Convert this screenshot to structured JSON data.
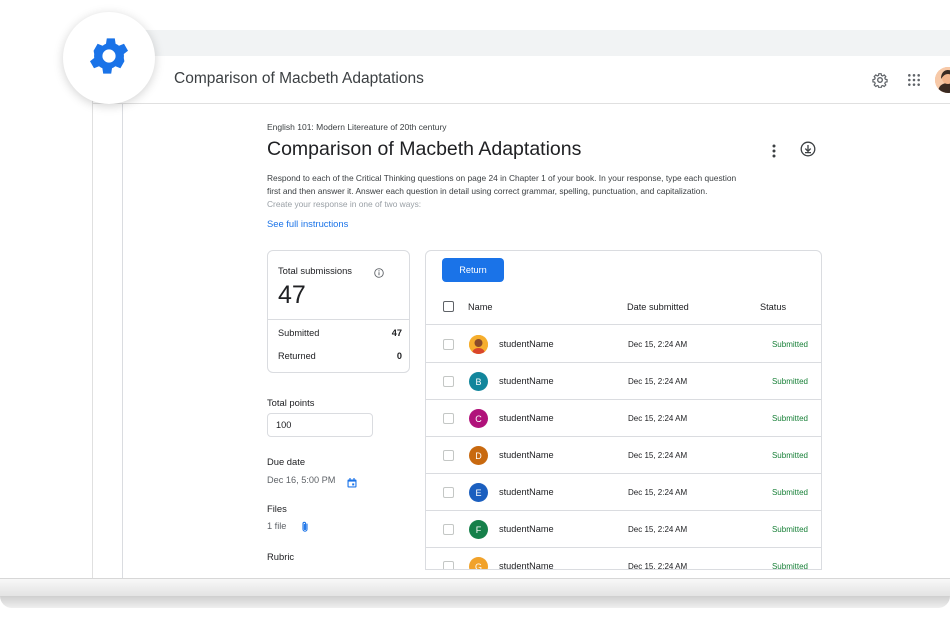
{
  "app": {
    "title": "Comparison of Macbeth Adaptations"
  },
  "header_icons": {
    "settings": "settings-gear-icon",
    "apps": "apps-grid-icon",
    "avatar": "user-avatar"
  },
  "assignment": {
    "course": "English 101: Modern Litereature of 20th century",
    "title": "Comparison of Macbeth Adaptations",
    "instructions_line1": "Respond to each of the Critical Thinking questions on page 24 in Chapter 1 of your book. In your response, type each question",
    "instructions_line2": "first and then answer it. Answer each question in detail using correct grammar, spelling, punctuation, and capitalization.",
    "instructions_line3": "Create your response in one of two ways:",
    "full_instructions_link": "See full instructions"
  },
  "submissions": {
    "label": "Total submissions",
    "total": "47",
    "submitted_label": "Submitted",
    "submitted_count": "47",
    "returned_label": "Returned",
    "returned_count": "0"
  },
  "details": {
    "points_label": "Total points",
    "points_value": "100",
    "due_label": "Due date",
    "due_value": "Dec 16, 5:00 PM",
    "files_label": "Files",
    "files_value": "1 file",
    "rubric_label": "Rubric"
  },
  "table": {
    "return_button": "Return",
    "columns": {
      "name": "Name",
      "date": "Date submitted",
      "status": "Status"
    },
    "rows": [
      {
        "initial": "",
        "avatar_color": "#f6ae2d",
        "name": "studentName",
        "date": "Dec 15, 2:24 AM",
        "status": "Submitted"
      },
      {
        "initial": "B",
        "avatar_color": "#12869c",
        "name": "studentName",
        "date": "Dec 15, 2:24 AM",
        "status": "Submitted"
      },
      {
        "initial": "C",
        "avatar_color": "#b0127a",
        "name": "studentName",
        "date": "Dec 15, 2:24 AM",
        "status": "Submitted"
      },
      {
        "initial": "D",
        "avatar_color": "#c8690f",
        "name": "studentName",
        "date": "Dec 15, 2:24 AM",
        "status": "Submitted"
      },
      {
        "initial": "E",
        "avatar_color": "#1b5fbf",
        "name": "studentName",
        "date": "Dec 15, 2:24 AM",
        "status": "Submitted"
      },
      {
        "initial": "F",
        "avatar_color": "#16804a",
        "name": "studentName",
        "date": "Dec 15, 2:24 AM",
        "status": "Submitted"
      },
      {
        "initial": "G",
        "avatar_color": "#f1a22a",
        "name": "studentName",
        "date": "Dec 15, 2:24 AM",
        "status": "Submitted"
      }
    ]
  },
  "colors": {
    "accent": "#1a73e8",
    "status_green": "#188038",
    "divider": "#dadce0"
  }
}
